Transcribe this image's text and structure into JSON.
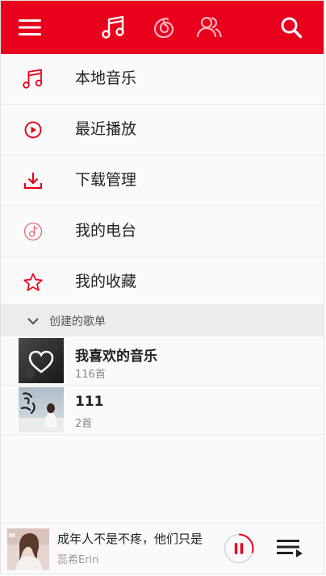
{
  "colors": {
    "brand": "#e8001c",
    "icon_active": "#ffffff",
    "icon_inactive": "#ffb3bb"
  },
  "topbar": {
    "menu_icon": "hamburger-menu-icon",
    "tabs": [
      {
        "icon": "music-note-icon",
        "active": true
      },
      {
        "icon": "disc-icon",
        "active": false
      },
      {
        "icon": "friends-icon",
        "active": false
      }
    ],
    "search_icon": "search-icon"
  },
  "menu": {
    "items": [
      {
        "label": "本地音乐",
        "icon": "music-note-icon"
      },
      {
        "label": "最近播放",
        "icon": "play-circle-icon"
      },
      {
        "label": "下载管理",
        "icon": "download-icon"
      },
      {
        "label": "我的电台",
        "icon": "radio-icon"
      },
      {
        "label": "我的收藏",
        "icon": "star-icon"
      }
    ]
  },
  "section": {
    "title": "创建的歌单",
    "icon": "chevron-down-icon"
  },
  "playlists": [
    {
      "name": "我喜欢的音乐",
      "count": "116首",
      "cover": "heart-cover"
    },
    {
      "name": "111",
      "count": "2首",
      "cover": "photo-cover"
    }
  ],
  "player": {
    "title": "成年人不是不疼，他们只是",
    "artist": "蕊希Erin",
    "progress": 0.3,
    "pause_icon": "pause-icon",
    "playlist_icon": "playlist-icon"
  }
}
